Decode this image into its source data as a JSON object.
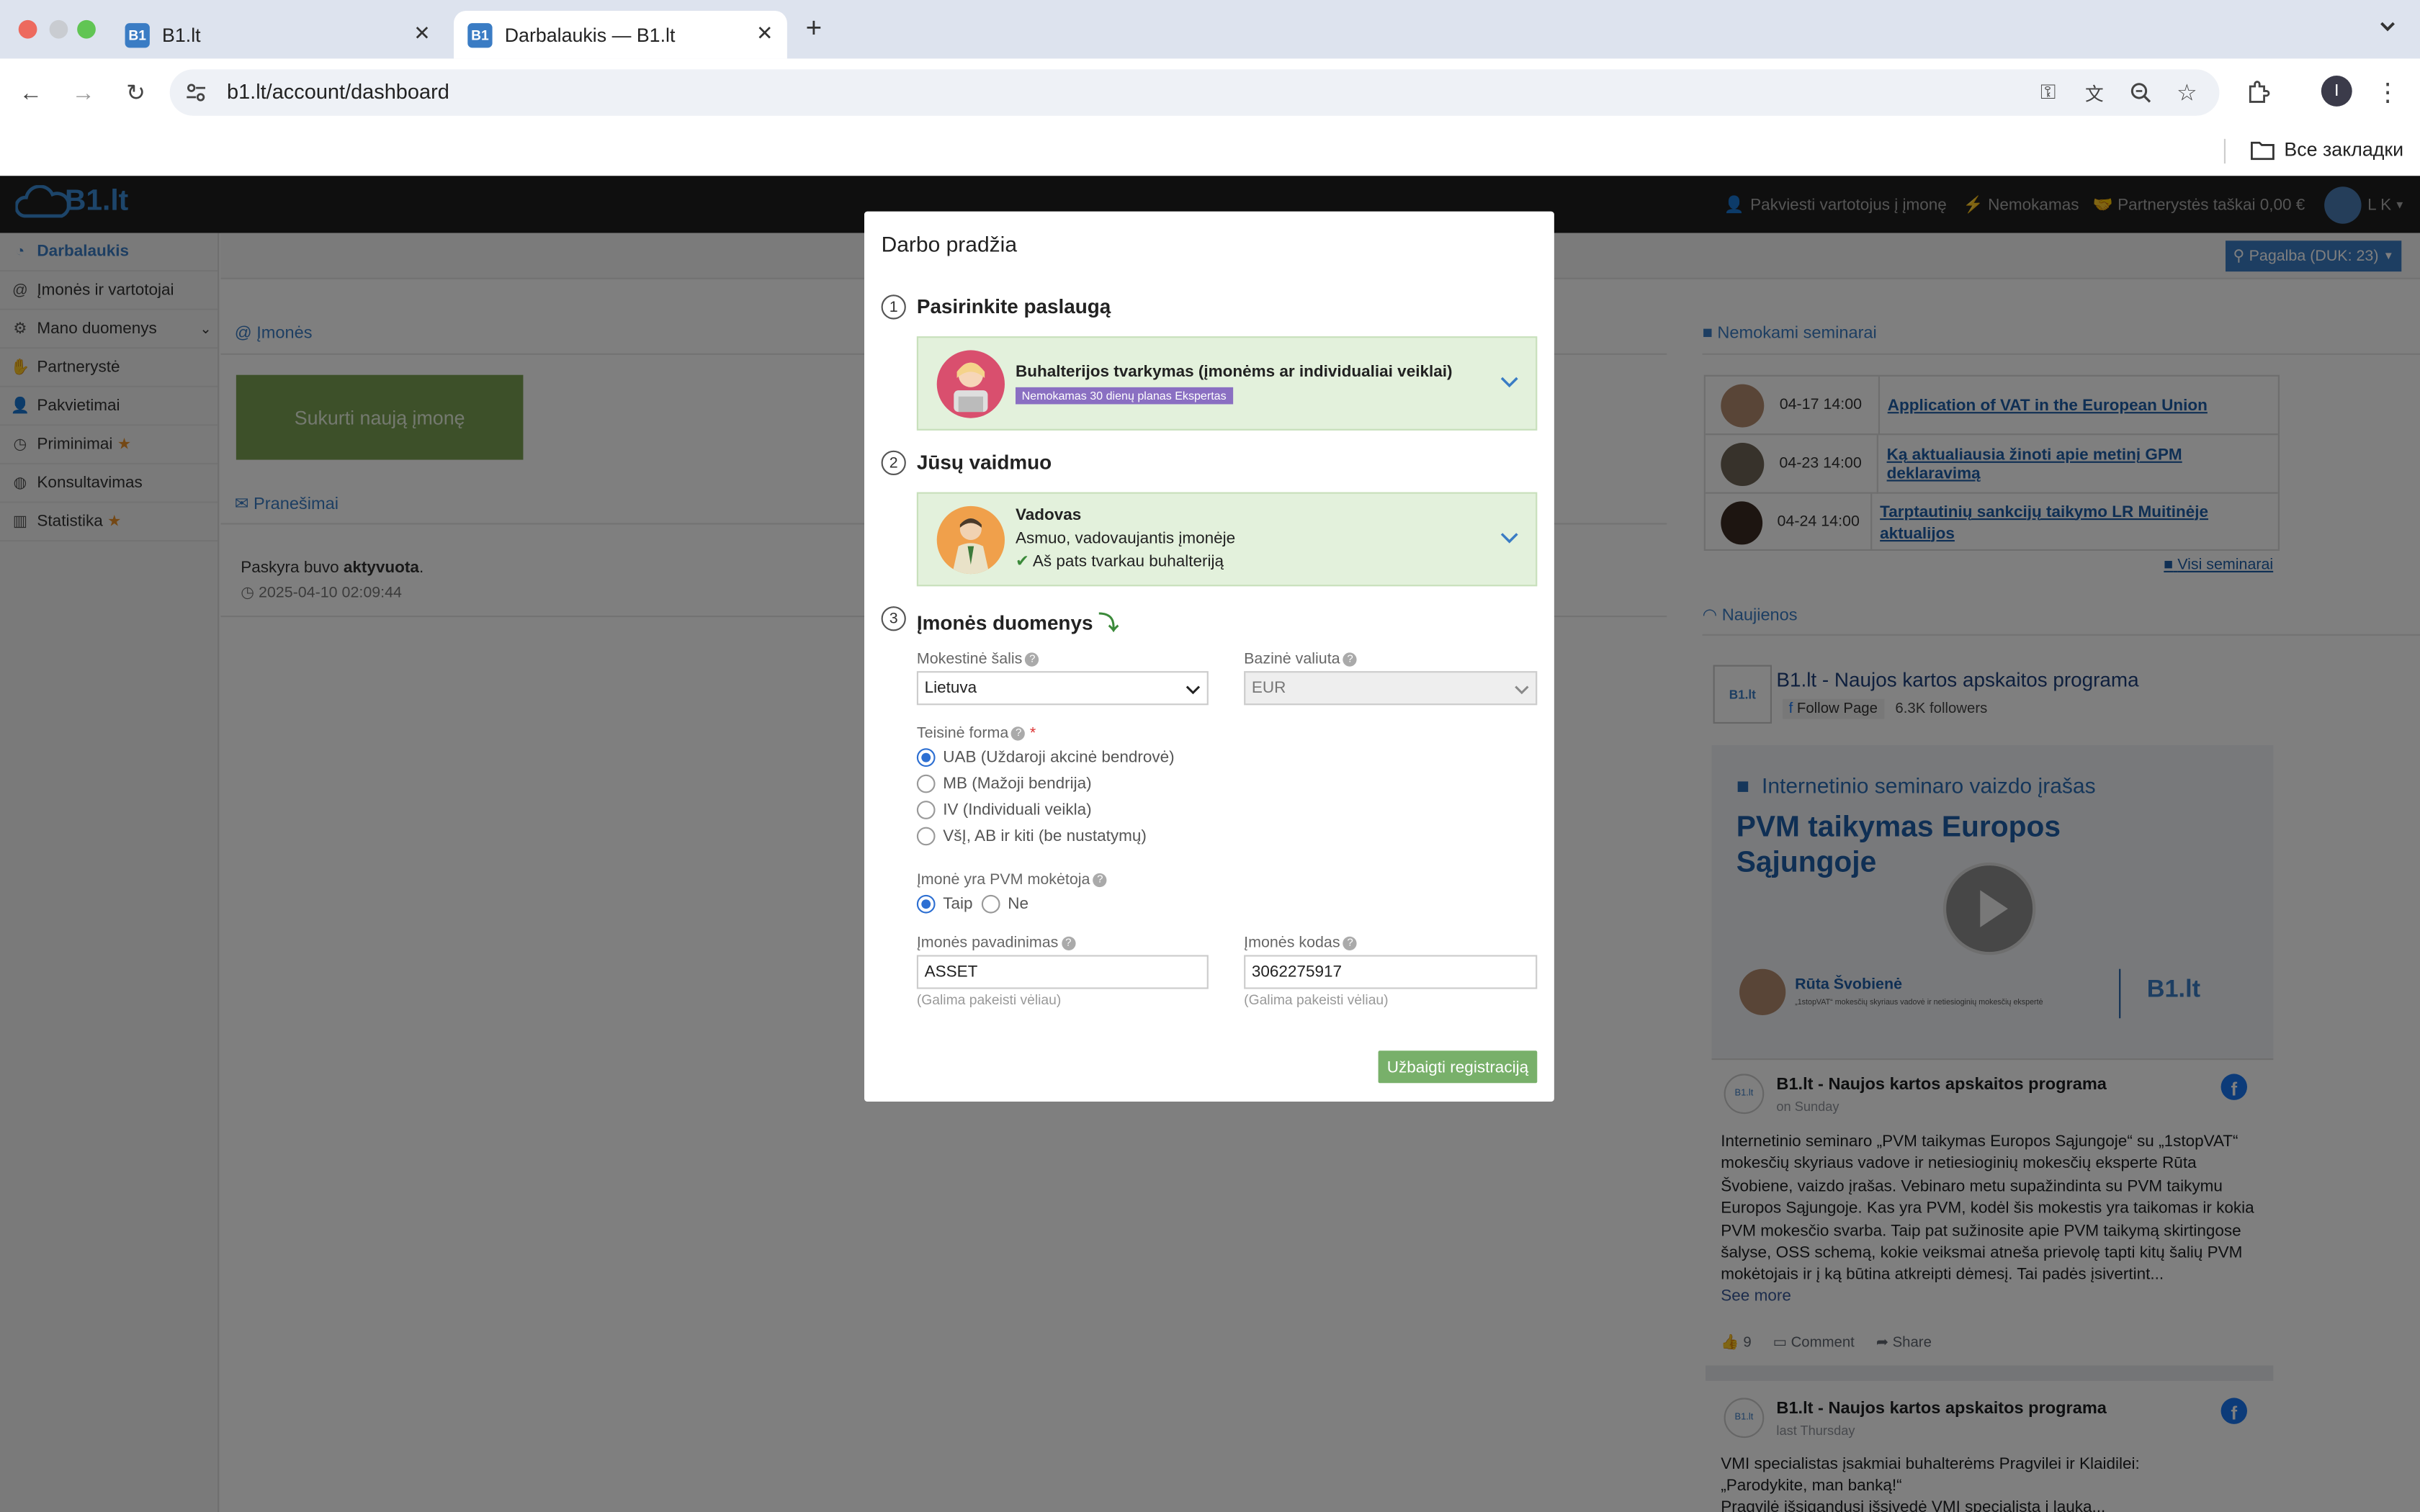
{
  "browser": {
    "tabs": [
      {
        "label": "B1.lt",
        "favicon": "B1"
      },
      {
        "label": "Darbalaukis — B1.lt",
        "favicon": "B1"
      }
    ],
    "url": "b1.lt/account/dashboard",
    "bookmarks_label": "Все закладки",
    "profile_initial": "I"
  },
  "app": {
    "logo": "B1.lt",
    "topnav": {
      "invite": "Pakviesti vartotojus į įmonę",
      "plan": "Nemokamas",
      "points": "Partnerystės taškai 0,00 €",
      "user": "L K"
    },
    "help_button": "Pagalba (DUK: 23)",
    "sidebar": [
      {
        "label": "Darbalaukis",
        "icon": "dashboard-icon",
        "active": true
      },
      {
        "label": "Įmonės ir vartotojai",
        "icon": "at-icon"
      },
      {
        "label": "Mano duomenys",
        "icon": "cogs-icon",
        "chevron": true
      },
      {
        "label": "Partnerystė",
        "icon": "handshake-icon"
      },
      {
        "label": "Pakvietimai",
        "icon": "user-plus-icon"
      },
      {
        "label": "Priminimai",
        "icon": "clock-icon",
        "star": true
      },
      {
        "label": "Konsultavimas",
        "icon": "globe-icon"
      },
      {
        "label": "Statistika",
        "icon": "bar-chart-icon",
        "star": true
      }
    ],
    "companies_heading": "Įmonės",
    "create_company": "Sukurti naują įmonę",
    "messages_heading": "Pranešimai",
    "message_prefix": "Paskyra buvo ",
    "message_bold": "aktyvuota",
    "message_suffix": ".",
    "message_time": "2025-04-10 02:09:44",
    "seminars_heading": "Nemokami seminarai",
    "seminars": [
      {
        "date": "04-17 14:00",
        "title": "Application of VAT in the European Union"
      },
      {
        "date": "04-23 14:00",
        "title": "Ką aktualiausia žinoti apie metinį GPM deklaravimą"
      },
      {
        "date": "04-24 14:00",
        "title": "Tarptautinių sankcijų taikymo LR Muitinėje aktualijos"
      }
    ],
    "all_seminars": "Visi seminarai",
    "news_heading": "Naujienos",
    "fb": {
      "page_name": "B1.lt - Naujos kartos apskaitos programa",
      "follow": "Follow Page",
      "followers": "6.3K followers",
      "video_label": "Internetinio seminaro vaizdo įrašas",
      "video_title": "PVM taikymas Europos Sąjungoje",
      "speaker": "Rūta Švobienė",
      "speaker_sub": "„1stopVAT“ mokesčių skyriaus vadovė ir netiesioginių mokesčių ekspertė",
      "post1_time": "on Sunday",
      "post1_text": "Internetinio seminaro „PVM taikymas Europos Sąjungoje“ su „1stopVAT“ mokesčių skyriaus vadove ir netiesioginių mokesčių eksperte Rūta Švobiene, vaizdo įrašas. Vebinaro metu supažindinta su PVM taikymu Europos Sąjungoje. Kas yra PVM, kodėl šis mokestis yra taikomas ir kokia PVM mokesčio svarba. Taip pat sužinosite apie PVM taikymą skirtingose šalyse, OSS schemą, kokie veiksmai atneša prievolę tapti kitų šalių PVM mokėtojais ir į ką būtina atkreipti dėmesį. Tai padės įsivertint...",
      "see_more": "See more",
      "likes": "9",
      "comment": "Comment",
      "share": "Share",
      "post2_time": "last Thursday",
      "post2_text": "VMI specialistas įsakmiai buhalterėms Pragvilei ir Klaidilei: „Parodykite, man banką!“",
      "post2_more": "Pragvilė išsigandusi išsivedė VMI specialistą į lauką..."
    }
  },
  "modal": {
    "title": "Darbo pradžia",
    "step1": {
      "num": "1",
      "title": "Pasirinkite paslaugą",
      "service": "Buhalterijos tvarkymas (įmonėms ar individualiai veiklai)",
      "badge": "Nemokamas 30 dienų planas Ekspertas"
    },
    "step2": {
      "num": "2",
      "title": "Jūsų vaidmuo",
      "role": "Vadovas",
      "desc": "Asmuo, vadovaujantis įmonėje",
      "check": "Aš pats tvarkau buhalteriją"
    },
    "step3": {
      "num": "3",
      "title": "Įmonės duomenys"
    },
    "country_label": "Mokestinė šalis",
    "country_value": "Lietuva",
    "currency_label": "Bazinė valiuta",
    "currency_value": "EUR",
    "legal_label": "Teisinė forma",
    "legal_options": [
      "UAB (Uždaroji akcinė bendrovė)",
      "MB (Mažoji bendrija)",
      "IV (Individuali veikla)",
      "VšĮ, AB ir kiti (be nustatymų)"
    ],
    "legal_selected": 0,
    "vat_label": "Įmonė yra PVM mokėtoja",
    "vat_yes": "Taip",
    "vat_no": "Ne",
    "name_label": "Įmonės pavadinimas",
    "name_value": "ASSET",
    "code_label": "Įmonės kodas",
    "code_value": "3062275917",
    "hint": "(Galima pakeisti vėliau)",
    "submit": "Užbaigti registraciją"
  },
  "colors": {
    "accent": "#3a7cc4",
    "green_button": "#7aa153",
    "submit": "#78b06a",
    "box_green": "#e3f1dc",
    "star": "#e8902a",
    "link": "#1f5fa8"
  }
}
